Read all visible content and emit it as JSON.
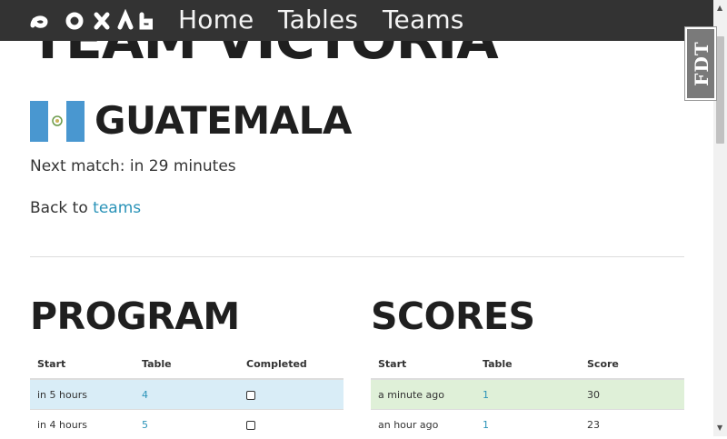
{
  "nav": {
    "logo_text": "IXORA",
    "links": [
      "Home",
      "Tables",
      "Teams"
    ]
  },
  "side_badge": {
    "text": "FDT"
  },
  "team": {
    "title": "TEAM VICTORIA",
    "country": "GUATEMALA",
    "next_match": "Next match: in 29 minutes",
    "back_prefix": "Back to ",
    "back_link": "teams"
  },
  "program": {
    "title": "PROGRAM",
    "headers": [
      "Start",
      "Table",
      "Completed"
    ],
    "rows": [
      {
        "start": "in 5 hours",
        "table": "4",
        "completed": false
      },
      {
        "start": "in 4 hours",
        "table": "5",
        "completed": false
      }
    ]
  },
  "scores": {
    "title": "SCORES",
    "headers": [
      "Start",
      "Table",
      "Score"
    ],
    "rows": [
      {
        "start": "a minute ago",
        "table": "1",
        "score": "30"
      },
      {
        "start": "an hour ago",
        "table": "1",
        "score": "23"
      }
    ]
  },
  "colors": {
    "navbar": "#333333",
    "link": "#2a93b8",
    "info_row": "#d9edf7",
    "success_row": "#dff0d8",
    "flag_blue": "#4997d0"
  }
}
